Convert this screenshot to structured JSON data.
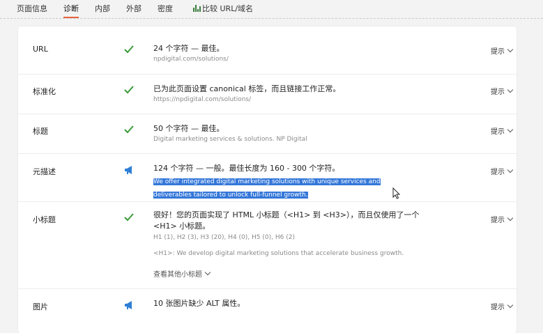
{
  "tabs": [
    {
      "label": "页面信息"
    },
    {
      "label": "诊断"
    },
    {
      "label": "内部"
    },
    {
      "label": "外部"
    },
    {
      "label": "密度"
    },
    {
      "label": "比较 URL/域名"
    }
  ],
  "colors": {
    "ok": "#3a9a3a",
    "warn": "#2f7fd6",
    "active_tab": "#e8663c",
    "selection": "#3477d9"
  },
  "rows": [
    {
      "label": "URL",
      "status": "check-icon",
      "message": "24 个字符 — 最佳。",
      "detail": "npdigital.com/solutions/",
      "hint": "提示"
    },
    {
      "label": "标准化",
      "status": "check-icon",
      "message": "已为此页面设置 canonical 标签，而且链接工作正常。",
      "detail": "https://npdigital.com/solutions/",
      "hint": "提示"
    },
    {
      "label": "标题",
      "status": "check-icon",
      "message": "50 个字符 — 最佳。",
      "detail": "Digital marketing services & solutions. NP Digital",
      "hint": "提示"
    },
    {
      "label": "元描述",
      "status": "megaphone-icon",
      "message": "124 个字符 — 一般。最佳长度为 160 - 300 个字符。",
      "detail_line1": "We offer integrated digital marketing solutions with unique services and",
      "detail_line2": "deliverables tailored to unlock full-funnel growth.",
      "hint": "提示"
    },
    {
      "label": "小标题",
      "status": "check-icon",
      "message_line1": "很好！您的页面实现了 HTML 小标题（<H1> 到 <H3>），而且仅使用了一个",
      "message_line2": "<H1> 小标题。",
      "counts": "H1 (1), H2 (3), H3 (20), H4 (0), H5 (0), H6 (2)",
      "h1_text": "<H1>: We develop digital marketing solutions that accelerate business growth.",
      "more_label": "查看其他小标题",
      "hint": "提示"
    },
    {
      "label": "图片",
      "status": "megaphone-icon",
      "message": "10 张图片缺少 ALT 属性。",
      "hint": "提示"
    }
  ]
}
